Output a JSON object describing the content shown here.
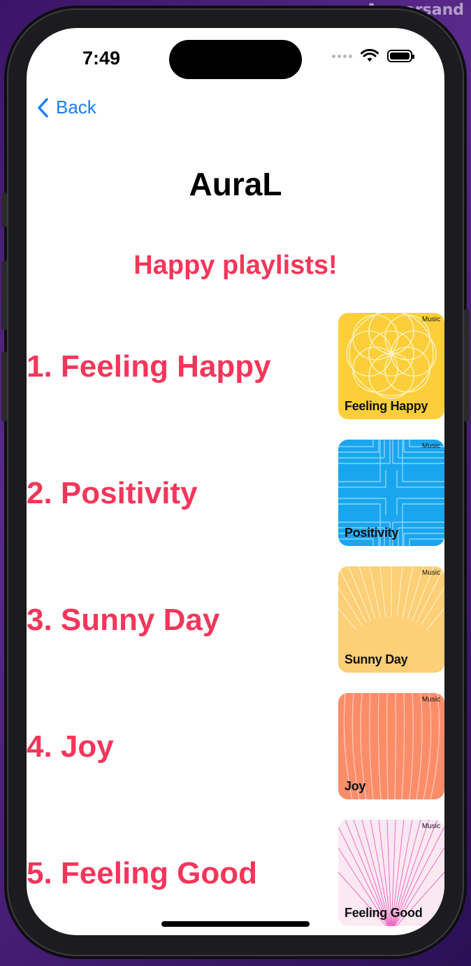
{
  "watermark": "Ampersand",
  "status_bar": {
    "time": "7:49"
  },
  "nav": {
    "back_label": "Back"
  },
  "app_title": "AuraL",
  "subtitle": "Happy playlists!",
  "playlists": [
    {
      "label": "1. Feeling Happy",
      "art_title": "Feeling Happy",
      "badge": "Music",
      "color": "#fccf3a"
    },
    {
      "label": "2. Positivity",
      "art_title": "Positivity",
      "badge": "Music",
      "color": "#1aa6ee"
    },
    {
      "label": "3. Sunny Day",
      "art_title": "Sunny Day",
      "badge": "Music",
      "color": "#fdcf76"
    },
    {
      "label": "4. Joy",
      "art_title": "Joy",
      "badge": "Music",
      "color": "#fd8d69"
    },
    {
      "label": "5. Feeling Good",
      "art_title": "Feeling Good",
      "badge": "Music",
      "color": "#fbe9f2"
    }
  ],
  "colors": {
    "accent": "#f4365a",
    "link": "#1a7cf5"
  }
}
